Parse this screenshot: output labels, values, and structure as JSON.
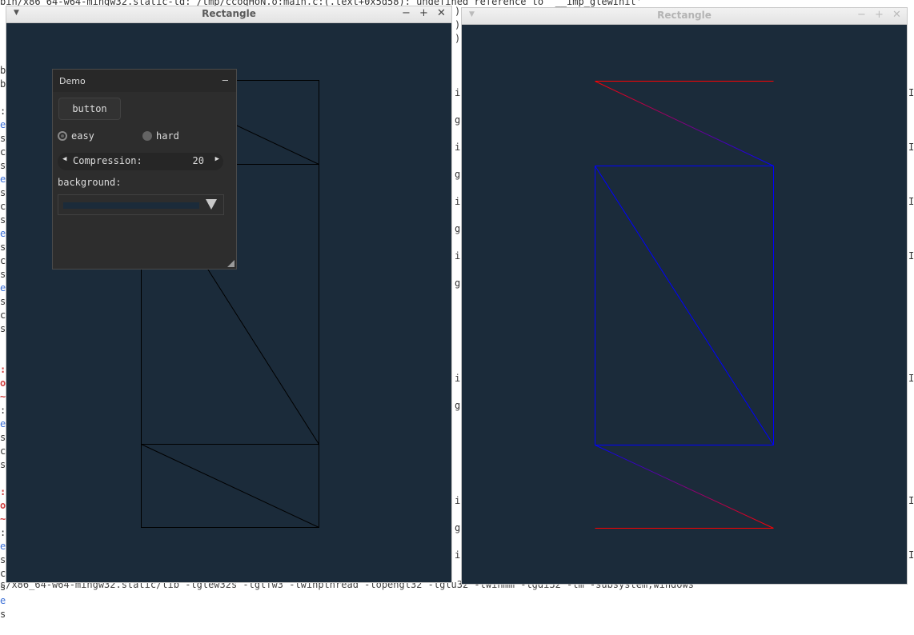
{
  "terminal": {
    "top_line": "bin/x86_64-w64-mingw32.static-ld: /tmp/ccoqHoN.o:main.c:(.text+0x5d58): undefined reference to `__imp_glewInit'",
    "bottom_line": "s/x86_64-w64-mingw32.static/lib -lglew32s -lglfw3 -lwinpthread -lopengl32 -lglu32 -lwinmm -lgdi32 -lm -subsystem,windows",
    "left_col": [
      {
        "t": "b",
        "c": "c-dark"
      },
      {
        "t": "b",
        "c": "c-dark"
      },
      {
        "t": "",
        "c": "c-dark"
      },
      {
        "t": ":",
        "c": "c-dark"
      },
      {
        "t": "e",
        "c": "c-blue"
      },
      {
        "t": "s",
        "c": "c-dark"
      },
      {
        "t": "c",
        "c": "c-dark"
      },
      {
        "t": "s",
        "c": "c-dark"
      },
      {
        "t": "e",
        "c": "c-blue"
      },
      {
        "t": "s",
        "c": "c-dark"
      },
      {
        "t": "c",
        "c": "c-dark"
      },
      {
        "t": "s",
        "c": "c-dark"
      },
      {
        "t": "e",
        "c": "c-blue"
      },
      {
        "t": "s",
        "c": "c-dark"
      },
      {
        "t": "c",
        "c": "c-dark"
      },
      {
        "t": "s",
        "c": "c-dark"
      },
      {
        "t": "e",
        "c": "c-blue"
      },
      {
        "t": "s",
        "c": "c-dark"
      },
      {
        "t": "c",
        "c": "c-dark"
      },
      {
        "t": "s",
        "c": "c-dark"
      },
      {
        "t": "",
        "c": "c-dark"
      },
      {
        "t": "",
        "c": "c-dark"
      },
      {
        "t": ":",
        "c": "c-red"
      },
      {
        "t": "o",
        "c": "c-red"
      },
      {
        "t": "~",
        "c": "c-red"
      },
      {
        "t": ":",
        "c": "c-dark"
      },
      {
        "t": "e",
        "c": "c-blue"
      },
      {
        "t": "s",
        "c": "c-dark"
      },
      {
        "t": "c",
        "c": "c-dark"
      },
      {
        "t": "s",
        "c": "c-dark"
      },
      {
        "t": "",
        "c": "c-dark"
      },
      {
        "t": ":",
        "c": "c-red"
      },
      {
        "t": "o",
        "c": "c-red"
      },
      {
        "t": "~",
        "c": "c-red"
      },
      {
        "t": ":",
        "c": "c-dark"
      },
      {
        "t": "e",
        "c": "c-blue"
      },
      {
        "t": "s",
        "c": "c-dark"
      },
      {
        "t": "c",
        "c": "c-dark"
      },
      {
        "t": "s",
        "c": "c-dark"
      },
      {
        "t": "e",
        "c": "c-blue"
      },
      {
        "t": "s",
        "c": "c-dark"
      },
      {
        "t": "",
        "c": "c-dark"
      }
    ],
    "mid_col": [
      ")",
      ")",
      ")",
      "",
      "",
      "",
      "i",
      "",
      "g",
      "",
      "i",
      "",
      "g",
      "",
      "i",
      "",
      "g",
      "",
      "i",
      "",
      "g",
      "",
      "",
      "",
      "",
      "",
      "",
      "i",
      "",
      "g",
      "",
      "",
      "",
      "",
      "",
      "",
      "i",
      "",
      "g",
      "",
      "i",
      ""
    ],
    "right_col": [
      "",
      "",
      "",
      "",
      "",
      "",
      "I",
      "",
      "",
      "",
      "I",
      "",
      "",
      "",
      "I",
      "",
      "",
      "",
      "I",
      "",
      "",
      "",
      "",
      "",
      "",
      "",
      "",
      "I",
      "",
      "",
      "",
      "",
      "",
      "",
      "",
      "",
      "I",
      "",
      "",
      "",
      "I",
      ""
    ]
  },
  "left_window": {
    "title": "Rectangle",
    "menu_icon": "triangle-down",
    "controls": [
      "−",
      "+",
      "✕"
    ],
    "background": "#1b2b3a",
    "stroke": "#000000"
  },
  "right_window": {
    "title": "Rectangle",
    "menu_icon": "triangle-down",
    "controls": [
      "−",
      "+",
      "✕"
    ],
    "background": "#1b2b3a",
    "outer_stroke": "#ff0000",
    "inner_stroke": "#0000ff"
  },
  "demo_panel": {
    "title": "Demo",
    "minimize": "–",
    "button_label": "button",
    "radio_easy": "easy",
    "radio_hard": "hard",
    "selected": "easy",
    "property_label": "Compression:",
    "property_value": "20",
    "arrow_left": "◀",
    "arrow_right": "▶",
    "background_label": "background:",
    "background_color": "#1b2b3a"
  }
}
